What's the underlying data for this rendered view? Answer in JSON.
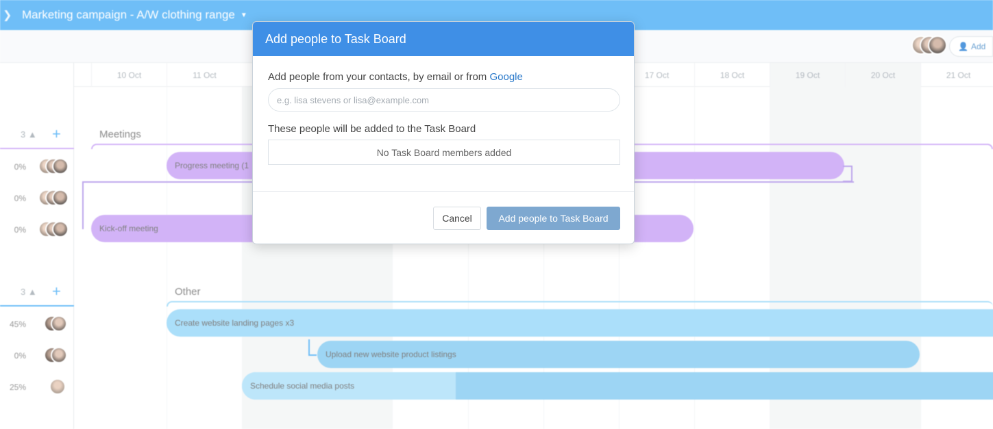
{
  "app": {
    "title": "Marketing campaign - A/W clothing range",
    "add_label": "Add"
  },
  "timeline": {
    "dates": [
      "10 Oct",
      "11 Oct",
      "17 Oct",
      "18 Oct",
      "19 Oct",
      "20 Oct",
      "21 Oct"
    ]
  },
  "groups": [
    {
      "label": "Meetings",
      "count": "3",
      "tasks": [
        {
          "name": "Progress meeting (1",
          "percent": "0%"
        },
        {
          "name": "",
          "percent": "0%"
        },
        {
          "name": "Kick-off meeting",
          "percent": "0%"
        }
      ]
    },
    {
      "label": "Other",
      "count": "3",
      "tasks": [
        {
          "name": "Create website landing pages x3",
          "percent": "45%"
        },
        {
          "name": "Upload new website product listings",
          "percent": "0%"
        },
        {
          "name": "Schedule social media posts",
          "percent": "25%",
          "progress": 0.28
        }
      ]
    }
  ],
  "modal": {
    "title": "Add people to Task Board",
    "contacts_label": "Add people from your contacts, by email or from",
    "google_link": "Google",
    "search_placeholder": "e.g. lisa stevens or lisa@example.com",
    "members_label": "These people will be added to the Task Board",
    "members_empty": "No Task Board members added",
    "cancel_label": "Cancel",
    "submit_label": "Add people to Task Board"
  },
  "colors": {
    "topbar": "#3fa9f5",
    "modal_header": "#3f8fe6",
    "meetings_bar": "#c39af5",
    "other_bar": "#8fd4f8",
    "submit_button": "#7ea8d0"
  }
}
